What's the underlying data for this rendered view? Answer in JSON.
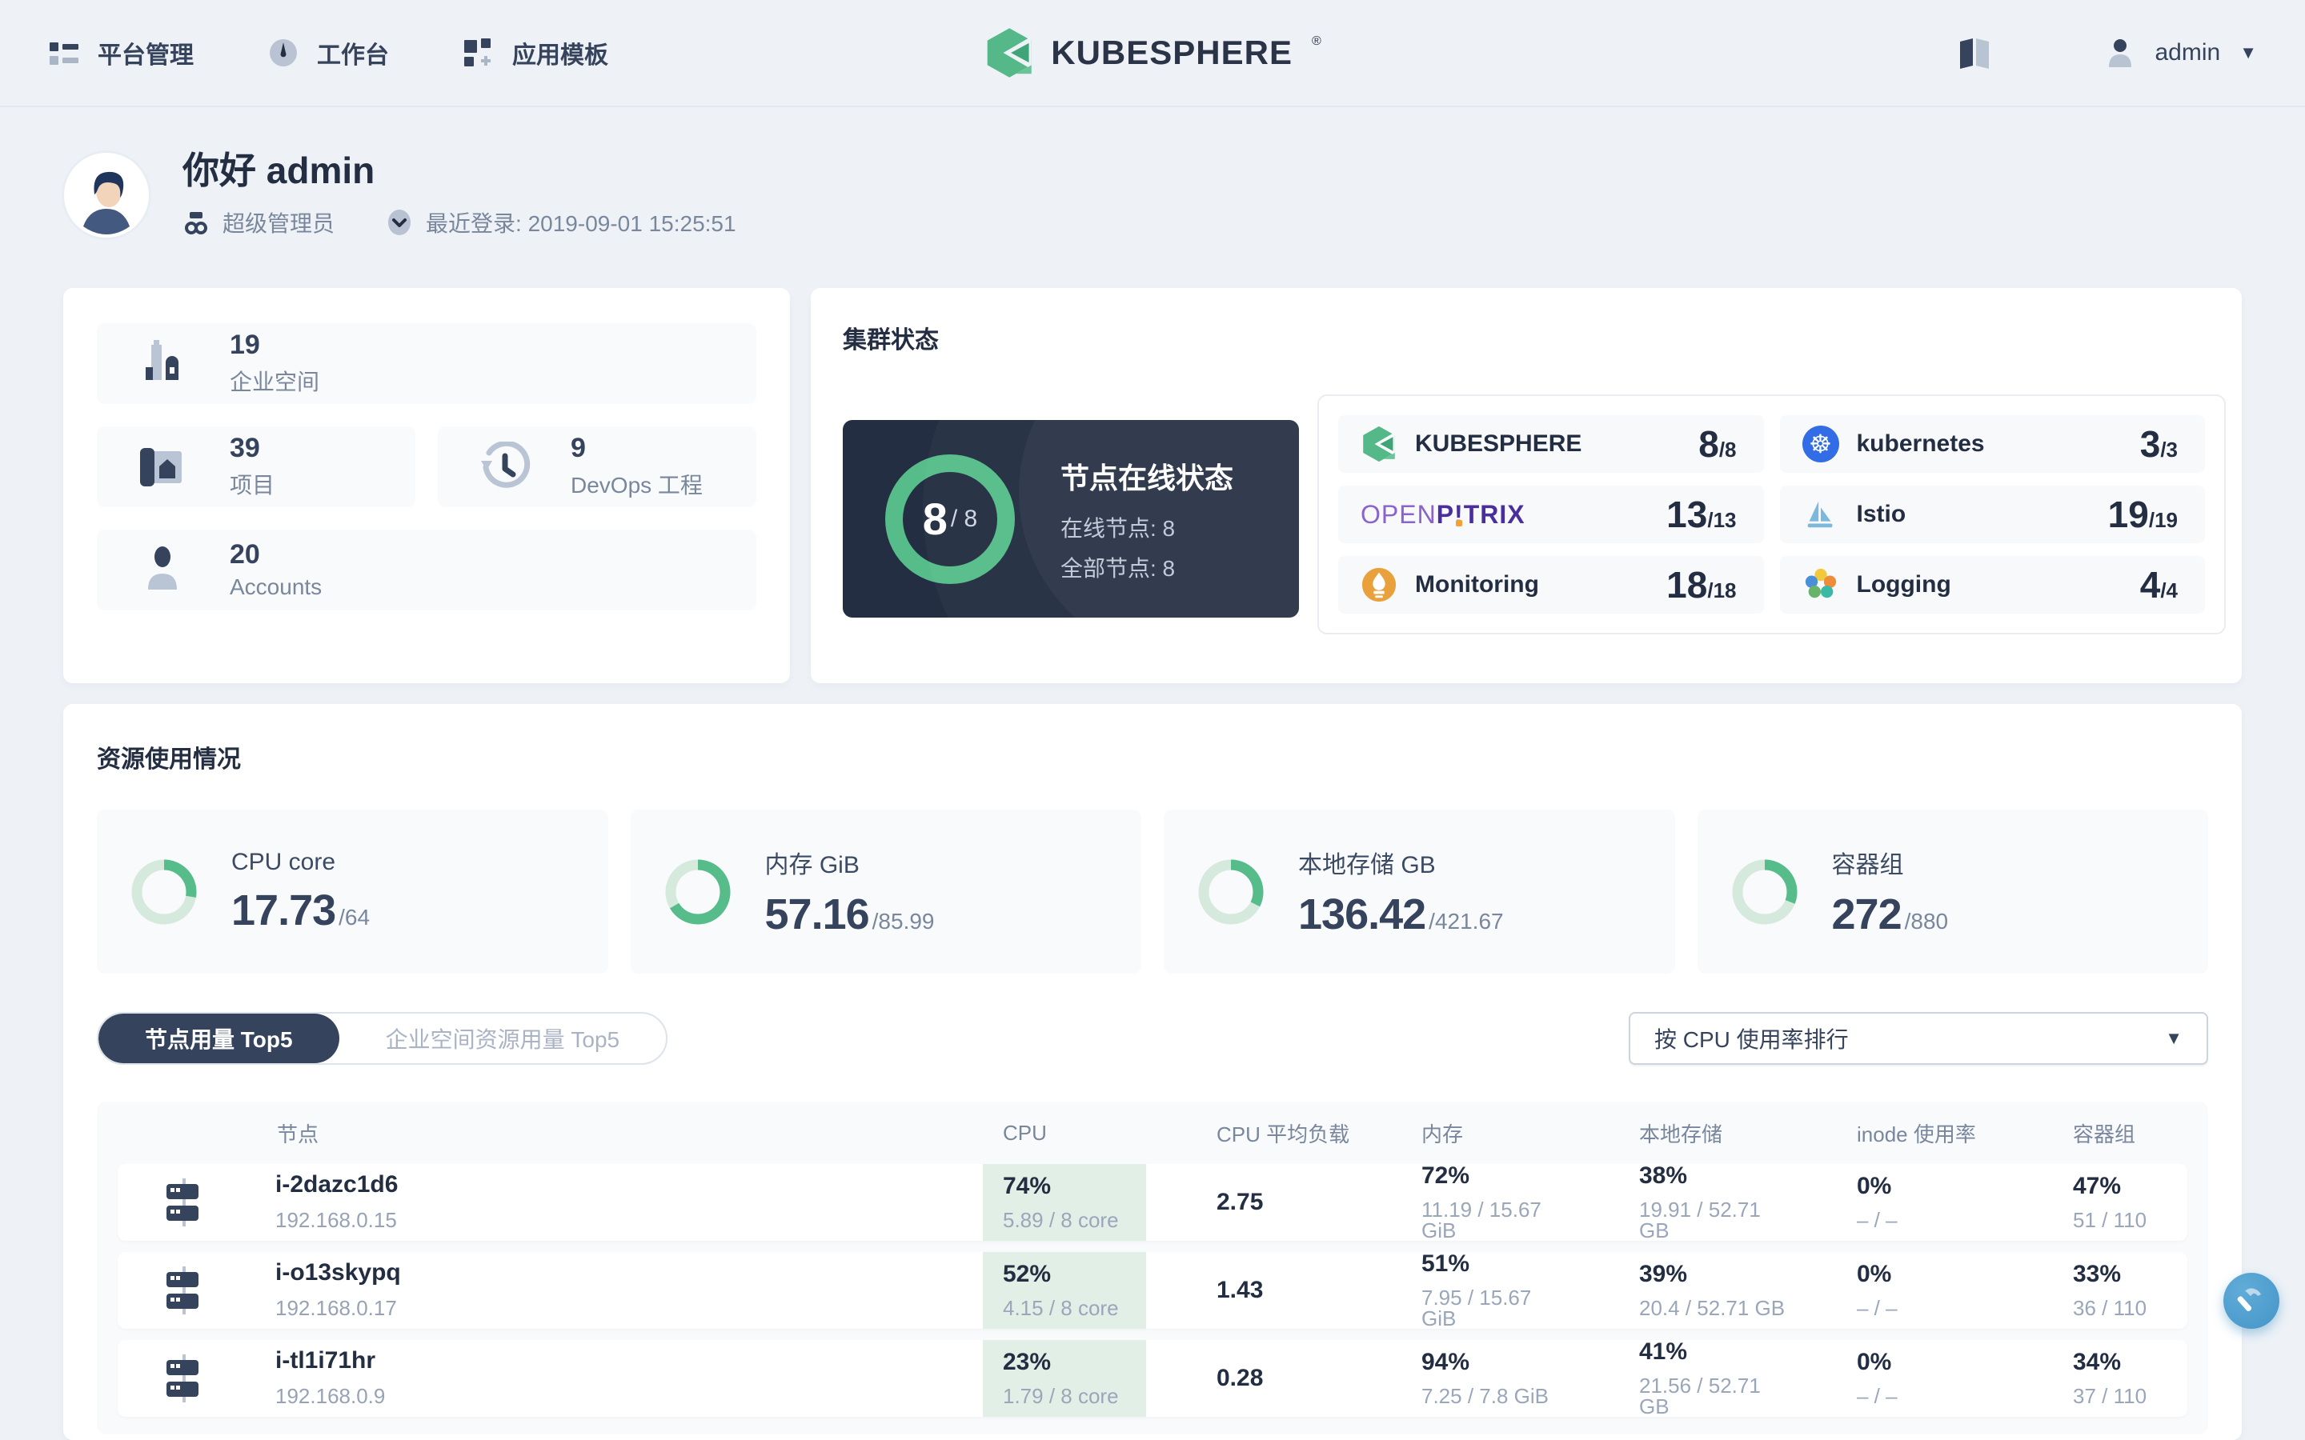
{
  "topbar": {
    "nav": [
      {
        "label": "平台管理"
      },
      {
        "label": "工作台"
      },
      {
        "label": "应用模板"
      }
    ],
    "logo_text": "KUBESPHERE",
    "logo_reg": "®",
    "username": "admin"
  },
  "greeting": {
    "hello": "你好 admin",
    "role": "超级管理员",
    "last_login": "最近登录: 2019-09-01 15:25:51"
  },
  "overview_cards": [
    {
      "value": "19",
      "label": "企业空间"
    },
    {
      "value": "39",
      "label": "项目"
    },
    {
      "value": "9",
      "label": "DevOps 工程"
    },
    {
      "value": "20",
      "label": "Accounts"
    }
  ],
  "cluster": {
    "title": "集群状态",
    "node_status": {
      "big": "8",
      "total": "/ 8",
      "heading": "节点在线状态",
      "line1": "在线节点: 8",
      "line2": "全部节点: 8",
      "percent": 100
    },
    "components": [
      {
        "name": "KUBESPHERE",
        "value": "8",
        "total": "/8"
      },
      {
        "name": "kubernetes",
        "value": "3",
        "total": "/3"
      },
      {
        "name": "OPENPITRIX",
        "value": "13",
        "total": "/13",
        "logo_open": "OPEN",
        "logo_p": "P",
        "logo_bang": "!",
        "logo_trix": "TRIX"
      },
      {
        "name": "Istio",
        "value": "19",
        "total": "/19"
      },
      {
        "name": "Monitoring",
        "value": "18",
        "total": "/18"
      },
      {
        "name": "Logging",
        "value": "4",
        "total": "/4"
      }
    ]
  },
  "resources": {
    "title": "资源使用情况",
    "cards": [
      {
        "label": "CPU core",
        "value": "17.73",
        "total": "/64",
        "percent": 27.7
      },
      {
        "label": "内存 GiB",
        "value": "57.16",
        "total": "/85.99",
        "percent": 66.5
      },
      {
        "label": "本地存储 GB",
        "value": "136.42",
        "total": "/421.67",
        "percent": 32.4
      },
      {
        "label": "容器组",
        "value": "272",
        "total": "/880",
        "percent": 30.9
      }
    ],
    "tabs": [
      {
        "label": "节点用量 Top5"
      },
      {
        "label": "企业空间资源用量 Top5"
      }
    ],
    "sort_select": "按 CPU 使用率排行",
    "table": {
      "headers": [
        "节点",
        "CPU",
        "CPU 平均负载",
        "内存",
        "本地存储",
        "inode 使用率",
        "容器组"
      ],
      "rows": [
        {
          "name": "i-2dazc1d6",
          "ip": "192.168.0.15",
          "cpu_pct": "74%",
          "cpu_detail": "5.89 / 8 core",
          "load": "2.75",
          "mem_pct": "72%",
          "mem_detail": "11.19 / 15.67 GiB",
          "disk_pct": "38%",
          "disk_detail": "19.91 / 52.71 GB",
          "inode_pct": "0%",
          "inode_detail": "– / –",
          "pods_pct": "47%",
          "pods_detail": "51 / 110"
        },
        {
          "name": "i-o13skypq",
          "ip": "192.168.0.17",
          "cpu_pct": "52%",
          "cpu_detail": "4.15 / 8 core",
          "load": "1.43",
          "mem_pct": "51%",
          "mem_detail": "7.95 / 15.67 GiB",
          "disk_pct": "39%",
          "disk_detail": "20.4 / 52.71 GB",
          "inode_pct": "0%",
          "inode_detail": "– / –",
          "pods_pct": "33%",
          "pods_detail": "36 / 110"
        },
        {
          "name": "i-tl1i71hr",
          "ip": "192.168.0.9",
          "cpu_pct": "23%",
          "cpu_detail": "1.79 / 8 core",
          "load": "0.28",
          "mem_pct": "94%",
          "mem_detail": "7.25 / 7.8 GiB",
          "disk_pct": "41%",
          "disk_detail": "21.56 / 52.71 GB",
          "inode_pct": "0%",
          "inode_detail": "– / –",
          "pods_pct": "34%",
          "pods_detail": "37 / 110"
        }
      ]
    }
  },
  "colors": {
    "accent_green": "#55bc8a",
    "dark_navy": "#242e42",
    "cpu_cell_green": "#e2efe7",
    "fab_blue": "#4595c7"
  }
}
